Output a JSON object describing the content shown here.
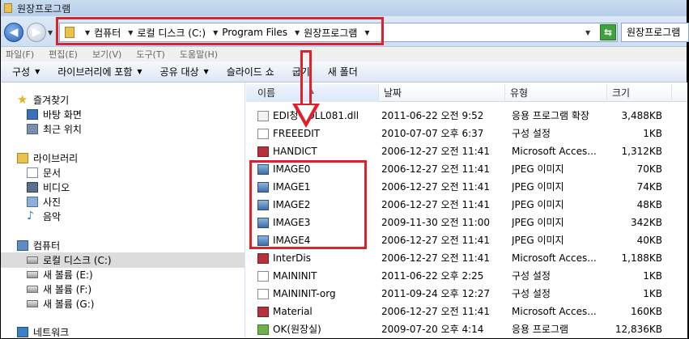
{
  "window": {
    "title": "원장프로그램"
  },
  "address": {
    "crumbs": [
      "컴퓨터",
      "로컬 디스크 (C:)",
      "Program Files",
      "원장프로그램"
    ],
    "search_value": "원장프로그램"
  },
  "menu": {
    "items": [
      "파일(F)",
      "편집(E)",
      "보기(V)",
      "도구(T)",
      "도움말(H)"
    ]
  },
  "toolbar": {
    "organize": "구성",
    "include_library": "라이브러리에 포함",
    "share": "공유 대상",
    "slideshow": "슬라이드 쇼",
    "burn": "굽기",
    "new_folder": "새 폴더"
  },
  "nav": {
    "favorites": "즐겨찾기",
    "desktop": "바탕 화면",
    "recent": "최근 위치",
    "libraries": "라이브러리",
    "documents": "문서",
    "videos": "비디오",
    "pictures": "사진",
    "music": "음악",
    "computer": "컴퓨터",
    "local_disk": "로컬 디스크 (C:)",
    "vol_e": "새 볼륨 (E:)",
    "vol_f": "새 볼륨 (F:)",
    "vol_g": "새 볼륨 (G:)",
    "network": "네트워크"
  },
  "columns": {
    "name": "이름",
    "date": "날짜",
    "type": "유형",
    "size": "크기"
  },
  "files": [
    {
      "name": "EDI청구DLL081.dll",
      "date": "2011-06-22 오전 9:52",
      "type": "응용 프로그램 확장",
      "size": "3,488KB",
      "icon": "dll-icon"
    },
    {
      "name": "FREEEDIT",
      "date": "2010-07-07 오후 6:37",
      "type": "구성 설정",
      "size": "1KB",
      "icon": "config-file-icon"
    },
    {
      "name": "HANDICT",
      "date": "2006-12-27 오전 11:41",
      "type": "Microsoft Acces...",
      "size": "1,312KB",
      "icon": "access-db-icon"
    },
    {
      "name": "IMAGE0",
      "date": "2006-12-27 오전 11:41",
      "type": "JPEG 이미지",
      "size": "70KB",
      "icon": "jpeg-icon"
    },
    {
      "name": "IMAGE1",
      "date": "2006-12-27 오전 11:41",
      "type": "JPEG 이미지",
      "size": "74KB",
      "icon": "jpeg-icon"
    },
    {
      "name": "IMAGE2",
      "date": "2006-12-27 오전 11:41",
      "type": "JPEG 이미지",
      "size": "48KB",
      "icon": "jpeg-icon"
    },
    {
      "name": "IMAGE3",
      "date": "2009-11-30 오전 11:00",
      "type": "JPEG 이미지",
      "size": "342KB",
      "icon": "jpeg-icon"
    },
    {
      "name": "IMAGE4",
      "date": "2006-12-27 오전 11:41",
      "type": "JPEG 이미지",
      "size": "40KB",
      "icon": "jpeg-icon"
    },
    {
      "name": "InterDis",
      "date": "2006-12-27 오전 11:41",
      "type": "Microsoft Acces...",
      "size": "1,188KB",
      "icon": "access-db-icon"
    },
    {
      "name": "MAININIT",
      "date": "2011-06-22 오후 2:25",
      "type": "구성 설정",
      "size": "1KB",
      "icon": "config-file-icon"
    },
    {
      "name": "MAININIT-org",
      "date": "2011-09-24 오후 12:27",
      "type": "구성 설정",
      "size": "1KB",
      "icon": "config-file-icon"
    },
    {
      "name": "Material",
      "date": "2006-12-27 오전 11:41",
      "type": "Microsoft Acces...",
      "size": "160KB",
      "icon": "access-db-icon"
    },
    {
      "name": "OK(원장실)",
      "date": "2009-07-20 오후 4:14",
      "type": "응용 프로그램",
      "size": "12,836KB",
      "icon": "exe-icon"
    }
  ],
  "colors": {
    "highlight_red": "#e0202a",
    "selection_gray": "#dcdcdc"
  }
}
